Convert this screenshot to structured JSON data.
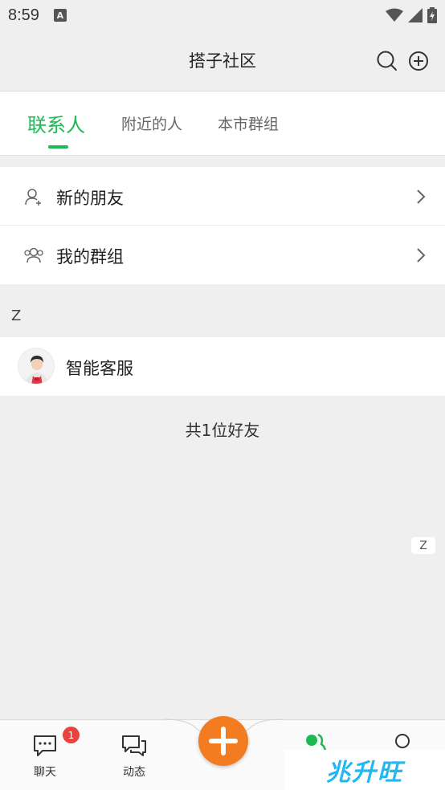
{
  "status_bar": {
    "time": "8:59",
    "notification_icon": "A"
  },
  "header": {
    "title": "搭子社区"
  },
  "tabs": [
    {
      "label": "联系人",
      "active": true
    },
    {
      "label": "附近的人",
      "active": false
    },
    {
      "label": "本市群组",
      "active": false
    }
  ],
  "menu": [
    {
      "label": "新的朋友",
      "icon": "add-user-icon"
    },
    {
      "label": "我的群组",
      "icon": "group-icon"
    }
  ],
  "section": {
    "letter": "Z"
  },
  "contacts": [
    {
      "name": "智能客服"
    }
  ],
  "friend_count": "共1位好友",
  "index": {
    "letter": "Z"
  },
  "bottom_nav": {
    "chat": {
      "label": "聊天",
      "badge": "1"
    },
    "moments": {
      "label": "动态"
    }
  },
  "watermark": "兆升旺",
  "colors": {
    "accent": "#1db954",
    "fab": "#f47c20",
    "badge": "#e8433f"
  }
}
